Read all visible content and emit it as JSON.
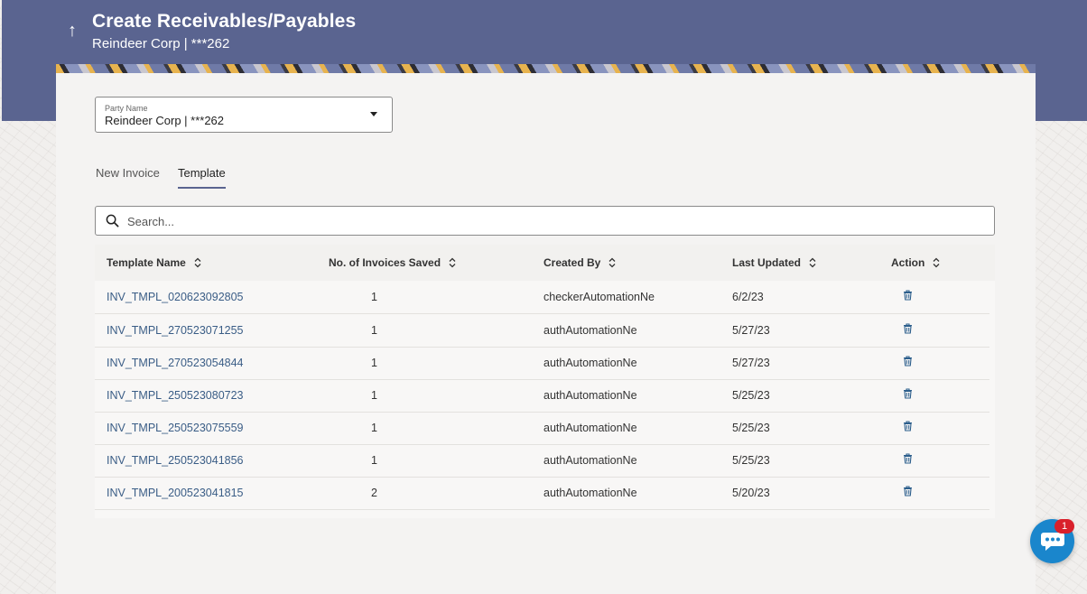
{
  "header": {
    "back_icon": "arrow-up-icon",
    "title": "Create Receivables/Payables",
    "subtitle": "Reindeer Corp | ***262"
  },
  "party": {
    "label": "Party Name",
    "value": "Reindeer Corp | ***262"
  },
  "tabs": [
    {
      "label": "New Invoice",
      "active": false
    },
    {
      "label": "Template",
      "active": true
    }
  ],
  "search": {
    "placeholder": "Search..."
  },
  "table": {
    "columns": [
      "Template Name",
      "No. of Invoices Saved",
      "Created By",
      "Last Updated",
      "Action"
    ],
    "rows": [
      {
        "name": "INV_TMPL_020623092805",
        "count": "1",
        "created_by": "checkerAutomationNe",
        "updated": "6/2/23"
      },
      {
        "name": "INV_TMPL_270523071255",
        "count": "1",
        "created_by": "authAutomationNe",
        "updated": "5/27/23"
      },
      {
        "name": "INV_TMPL_270523054844",
        "count": "1",
        "created_by": "authAutomationNe",
        "updated": "5/27/23"
      },
      {
        "name": "INV_TMPL_250523080723",
        "count": "1",
        "created_by": "authAutomationNe",
        "updated": "5/25/23"
      },
      {
        "name": "INV_TMPL_250523075559",
        "count": "1",
        "created_by": "authAutomationNe",
        "updated": "5/25/23"
      },
      {
        "name": "INV_TMPL_250523041856",
        "count": "1",
        "created_by": "authAutomationNe",
        "updated": "5/25/23"
      },
      {
        "name": "INV_TMPL_200523041815",
        "count": "2",
        "created_by": "authAutomationNe",
        "updated": "5/20/23"
      }
    ]
  },
  "chat": {
    "badge": "1",
    "icon": "chat-bubble-icon"
  },
  "colors": {
    "header_bg": "#5a6490",
    "link": "#3a5d86",
    "accent": "#1a86cc",
    "badge": "#d9202b"
  }
}
